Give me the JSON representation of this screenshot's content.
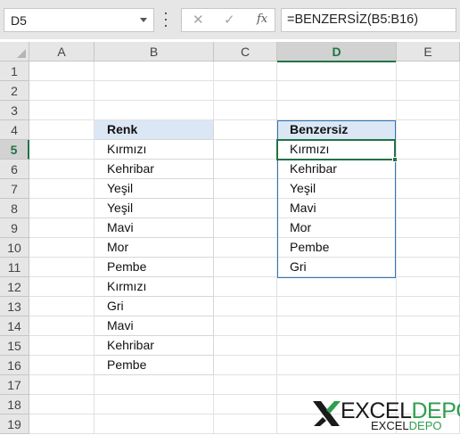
{
  "formula_bar": {
    "name_box": "D5",
    "cancel_glyph": "✕",
    "enter_glyph": "✓",
    "fx_label": "fx",
    "formula": "=BENZERSİZ(B5:B16)"
  },
  "columns": [
    "A",
    "B",
    "C",
    "D",
    "E"
  ],
  "selected_column": "D",
  "rows": [
    "1",
    "2",
    "3",
    "4",
    "5",
    "6",
    "7",
    "8",
    "9",
    "10",
    "11",
    "12",
    "13",
    "14",
    "15",
    "16",
    "17",
    "18",
    "19"
  ],
  "selected_row": "5",
  "source_table": {
    "header": "Renk",
    "items": [
      "Kırmızı",
      "Kehribar",
      "Yeşil",
      "Yeşil",
      "Mavi",
      "Mor",
      "Pembe",
      "Kırmızı",
      "Gri",
      "Mavi",
      "Kehribar",
      "Pembe"
    ]
  },
  "unique_table": {
    "header": "Benzersiz",
    "items": [
      "Kırmızı",
      "Kehribar",
      "Yeşil",
      "Mavi",
      "Mor",
      "Pembe",
      "Gri"
    ]
  },
  "logo": {
    "word_dark": "EXCEL",
    "word_accent": "DEPO",
    "small_dark": "EXCEL",
    "small_accent": "DEPO",
    "colors": {
      "dark": "#1a1a1a",
      "accent": "#2e9e4f"
    }
  },
  "colors": {
    "accent_green": "#217346",
    "table_blue_border": "#2f75b5",
    "table_header_fill": "#dbe7f5"
  }
}
